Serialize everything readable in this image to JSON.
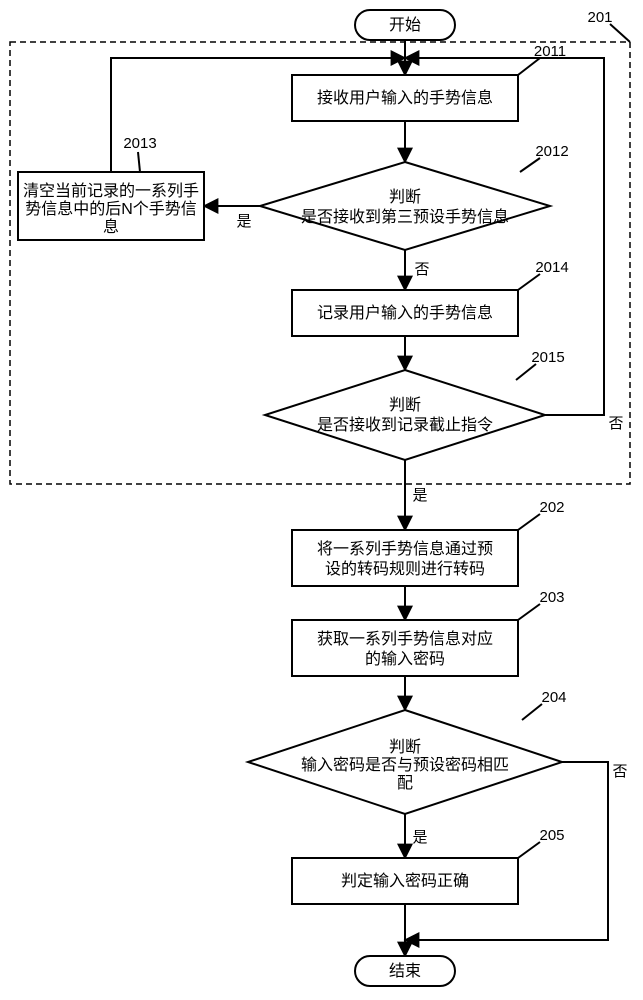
{
  "terminals": {
    "start": "开始",
    "end": "结束"
  },
  "nodes": {
    "n2011": "接收用户输入的手势信息",
    "n2013_l1": "清空当前记录的一系列手",
    "n2013_l2": "势信息中的后N个手势信",
    "n2013_l3": "息",
    "n2012_l1": "判断",
    "n2012_l2": "是否接收到第三预设手势信息",
    "n2014": "记录用户输入的手势信息",
    "n2015_l1": "判断",
    "n2015_l2": "是否接收到记录截止指令",
    "n202_l1": "将一系列手势信息通过预",
    "n202_l2": "设的转码规则进行转码",
    "n203_l1": "获取一系列手势信息对应",
    "n203_l2": "的输入密码",
    "n204_l1": "判断",
    "n204_l2": "输入密码是否与预设密码相匹",
    "n204_l3": "配",
    "n205": "判定输入密码正确"
  },
  "labels": {
    "yes": "是",
    "no": "否"
  },
  "callouts": {
    "c201": "201",
    "c2011": "2011",
    "c2012": "2012",
    "c2013": "2013",
    "c2014": "2014",
    "c2015": "2015",
    "c202": "202",
    "c203": "203",
    "c204": "204",
    "c205": "205"
  }
}
